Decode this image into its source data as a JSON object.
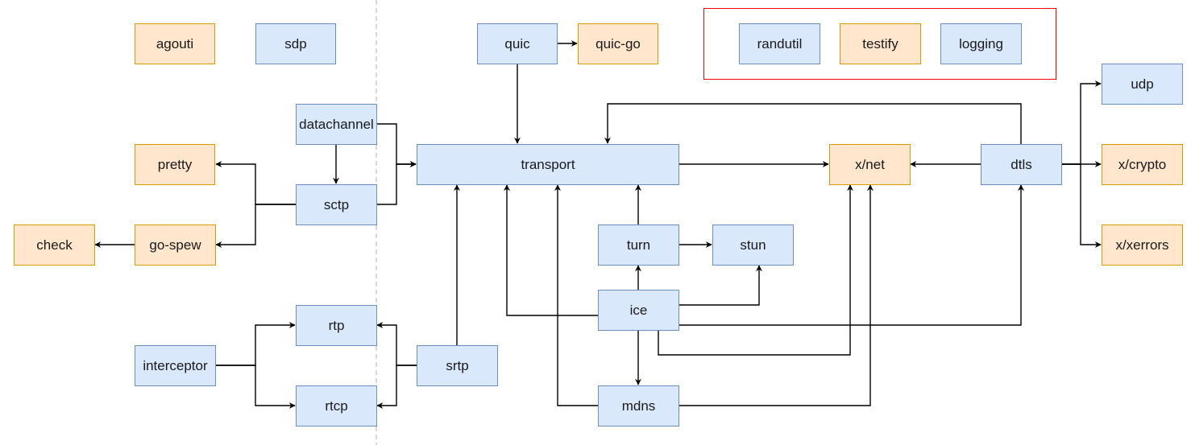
{
  "diagram": {
    "colors": {
      "internal_fill": "#dae8fc",
      "internal_stroke": "#6c8ebf",
      "external_fill": "#ffe6cc",
      "external_stroke": "#d79b00",
      "group_stroke": "#ff0000",
      "edge": "#000000",
      "divider": "#cccccc"
    },
    "nodes": [
      {
        "id": "agouti",
        "label": "agouti",
        "kind": "external"
      },
      {
        "id": "sdp",
        "label": "sdp",
        "kind": "internal"
      },
      {
        "id": "quic",
        "label": "quic",
        "kind": "internal"
      },
      {
        "id": "quic-go",
        "label": "quic-go",
        "kind": "external"
      },
      {
        "id": "randutil",
        "label": "randutil",
        "kind": "internal"
      },
      {
        "id": "testify",
        "label": "testify",
        "kind": "external"
      },
      {
        "id": "logging",
        "label": "logging",
        "kind": "internal"
      },
      {
        "id": "udp",
        "label": "udp",
        "kind": "internal"
      },
      {
        "id": "datachannel",
        "label": "datachannel",
        "kind": "internal"
      },
      {
        "id": "pretty",
        "label": "pretty",
        "kind": "external"
      },
      {
        "id": "sctp",
        "label": "sctp",
        "kind": "internal"
      },
      {
        "id": "transport",
        "label": "transport",
        "kind": "internal"
      },
      {
        "id": "x-net",
        "label": "x/net",
        "kind": "external"
      },
      {
        "id": "dtls",
        "label": "dtls",
        "kind": "internal"
      },
      {
        "id": "x-crypto",
        "label": "x/crypto",
        "kind": "external"
      },
      {
        "id": "check",
        "label": "check",
        "kind": "external"
      },
      {
        "id": "go-spew",
        "label": "go-spew",
        "kind": "external"
      },
      {
        "id": "turn",
        "label": "turn",
        "kind": "internal"
      },
      {
        "id": "stun",
        "label": "stun",
        "kind": "internal"
      },
      {
        "id": "x-xerrors",
        "label": "x/xerrors",
        "kind": "external"
      },
      {
        "id": "ice",
        "label": "ice",
        "kind": "internal"
      },
      {
        "id": "rtp",
        "label": "rtp",
        "kind": "internal"
      },
      {
        "id": "interceptor",
        "label": "interceptor",
        "kind": "internal"
      },
      {
        "id": "srtp",
        "label": "srtp",
        "kind": "internal"
      },
      {
        "id": "rtcp",
        "label": "rtcp",
        "kind": "internal"
      },
      {
        "id": "mdns",
        "label": "mdns",
        "kind": "internal"
      }
    ],
    "group": {
      "name": "utility-group",
      "members": [
        "randutil",
        "testify",
        "logging"
      ]
    },
    "edges": [
      {
        "from": "quic",
        "to": "quic-go"
      },
      {
        "from": "quic",
        "to": "transport"
      },
      {
        "from": "datachannel",
        "to": "sctp"
      },
      {
        "from": "datachannel",
        "to": "transport"
      },
      {
        "from": "sctp",
        "to": "transport"
      },
      {
        "from": "sctp",
        "to": "pretty"
      },
      {
        "from": "sctp",
        "to": "go-spew"
      },
      {
        "from": "go-spew",
        "to": "check"
      },
      {
        "from": "interceptor",
        "to": "rtp"
      },
      {
        "from": "interceptor",
        "to": "rtcp"
      },
      {
        "from": "srtp",
        "to": "rtp"
      },
      {
        "from": "srtp",
        "to": "rtcp"
      },
      {
        "from": "srtp",
        "to": "transport"
      },
      {
        "from": "ice",
        "to": "transport"
      },
      {
        "from": "mdns",
        "to": "transport"
      },
      {
        "from": "turn",
        "to": "transport"
      },
      {
        "from": "turn",
        "to": "stun"
      },
      {
        "from": "ice",
        "to": "turn"
      },
      {
        "from": "ice",
        "to": "stun"
      },
      {
        "from": "ice",
        "to": "mdns"
      },
      {
        "from": "ice",
        "to": "dtls"
      },
      {
        "from": "ice",
        "to": "x-net"
      },
      {
        "from": "mdns",
        "to": "x-net"
      },
      {
        "from": "transport",
        "to": "x-net"
      },
      {
        "from": "dtls",
        "to": "x-net"
      },
      {
        "from": "dtls",
        "to": "transport"
      },
      {
        "from": "dtls",
        "to": "udp"
      },
      {
        "from": "dtls",
        "to": "x-crypto"
      },
      {
        "from": "dtls",
        "to": "x-xerrors"
      }
    ]
  }
}
